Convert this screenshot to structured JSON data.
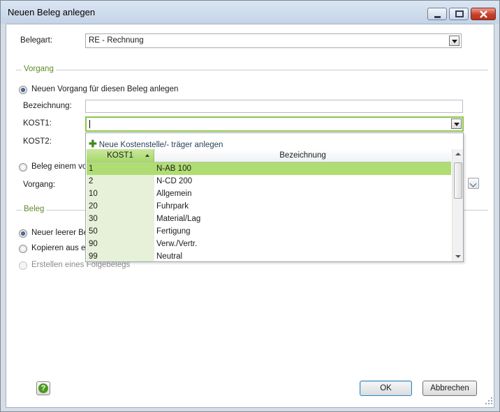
{
  "window": {
    "title": "Neuen Beleg anlegen"
  },
  "belegart": {
    "label": "Belegart:",
    "value": "RE - Rechnung"
  },
  "vorgang_section": {
    "title": "Vorgang",
    "radio_new": "Neuen Vorgang für diesen Beleg anlegen",
    "bezeichnung_label": "Bezeichnung:",
    "bezeichnung_value": "",
    "kost1_label": "KOST1:",
    "kost1_value": "",
    "kost2_label": "KOST2:",
    "radio_assign": "Beleg einem vor",
    "vorgang_label": "Vorgang:"
  },
  "beleg_section": {
    "title": "Beleg",
    "radio_empty": "Neuer leerer Bel",
    "radio_copy": "Kopieren aus ein",
    "radio_follow": "Erstellen eines Folgebelegs"
  },
  "dropdown": {
    "new_link": "Neue Kostenstelle/- träger anlegen",
    "columns": [
      "KOST1",
      "Bezeichnung"
    ],
    "rows": [
      {
        "kost": "1",
        "bez": "N-AB 100",
        "selected": true
      },
      {
        "kost": "2",
        "bez": "N-CD 200"
      },
      {
        "kost": "10",
        "bez": "Allgemein"
      },
      {
        "kost": "20",
        "bez": "Fuhrpark"
      },
      {
        "kost": "30",
        "bez": "Material/Lag"
      },
      {
        "kost": "50",
        "bez": "Fertigung"
      },
      {
        "kost": "90",
        "bez": "Verw./Vertr."
      },
      {
        "kost": "99",
        "bez": "Neutral"
      }
    ]
  },
  "buttons": {
    "ok": "OK",
    "cancel": "Abbrechen",
    "help": "?"
  },
  "colors": {
    "accent_green": "#b0dd73",
    "section_title": "#5f8a28",
    "close_red": "#c8402a"
  }
}
